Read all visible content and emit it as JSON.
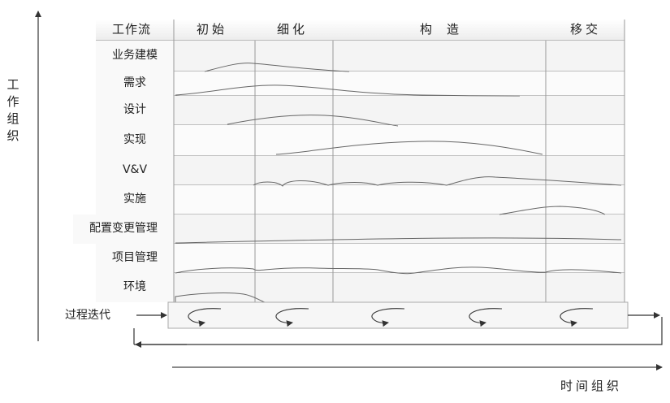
{
  "axes": {
    "y_label": "工作组织",
    "x_label": "时间组织"
  },
  "header": {
    "workflow_label": "工作流",
    "phases": [
      "初始",
      "细化",
      "构造",
      "移交"
    ]
  },
  "workflows": [
    "业务建模",
    "需求",
    "设计",
    "实现",
    "V&V",
    "实施",
    "配置变更管理",
    "项目管理",
    "环境"
  ],
  "iteration": {
    "label": "过程迭代",
    "count": 5
  }
}
